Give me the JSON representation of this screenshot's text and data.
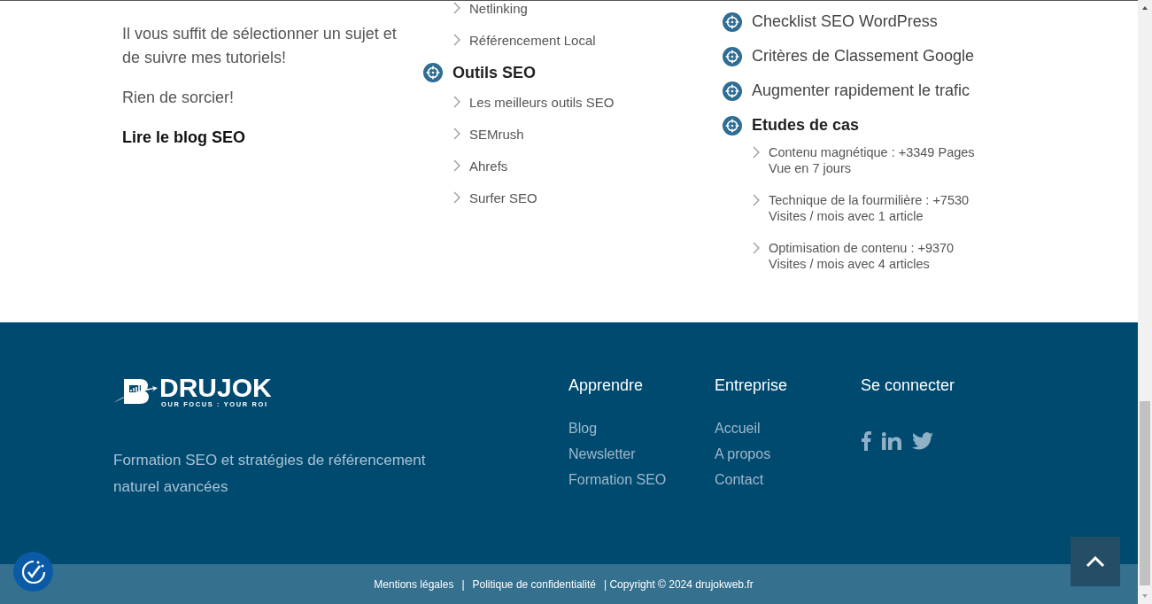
{
  "intro": {
    "paragraphs": [
      "Il vous suffit de sélectionner un sujet et de suivre mes tutoriels!",
      "Rien de sorcier!"
    ],
    "link": "Lire le blog SEO"
  },
  "middle_column": [
    {
      "kind": "sublink",
      "label": "Netlinking"
    },
    {
      "kind": "sublink",
      "label": "Référencement Local"
    },
    {
      "kind": "heading",
      "label": "Outils SEO"
    },
    {
      "kind": "sublink",
      "label": "Les meilleurs outils SEO"
    },
    {
      "kind": "sublink",
      "label": "SEMrush"
    },
    {
      "kind": "sublink",
      "label": "Ahrefs"
    },
    {
      "kind": "sublink",
      "label": "Surfer SEO"
    }
  ],
  "right_column": [
    {
      "kind": "link",
      "label": "Checklist SEO WordPress"
    },
    {
      "kind": "link",
      "label": "Critères de Classement Google"
    },
    {
      "kind": "link",
      "label": "Augmenter rapidement le trafic"
    },
    {
      "kind": "heading",
      "label": "Etudes de cas"
    },
    {
      "kind": "case",
      "lines": [
        "Contenu magnétique : +3349 Pages",
        "Vue en 7 jours"
      ]
    },
    {
      "kind": "case",
      "lines": [
        "Technique de la fourmilière : +7530",
        "Visites / mois avec 1 article"
      ]
    },
    {
      "kind": "case",
      "lines": [
        "Optimisation de contenu : +9370",
        "Visites / mois avec 4 articles"
      ]
    }
  ],
  "footer": {
    "logo": {
      "name": "DRUJOK",
      "tagline": "OUR FOCUS : YOUR ROI"
    },
    "description": "Formation SEO et stratégies de référencement naturel avancées",
    "columns": [
      {
        "title": "Apprendre",
        "links": [
          "Blog",
          "Newsletter",
          "Formation SEO"
        ]
      },
      {
        "title": "Entreprise",
        "links": [
          "Accueil",
          "A propos",
          "Contact"
        ]
      }
    ],
    "social": {
      "title": "Se connecter",
      "networks": [
        {
          "kind": "facebook"
        },
        {
          "kind": "linkedin"
        },
        {
          "kind": "twitter"
        }
      ]
    }
  },
  "bottom_bar": {
    "links": [
      "Mentions légales",
      "Politique de confidentialité"
    ],
    "separator": "|",
    "copyright": "| Copyright © 2024 drujokweb.fr"
  }
}
